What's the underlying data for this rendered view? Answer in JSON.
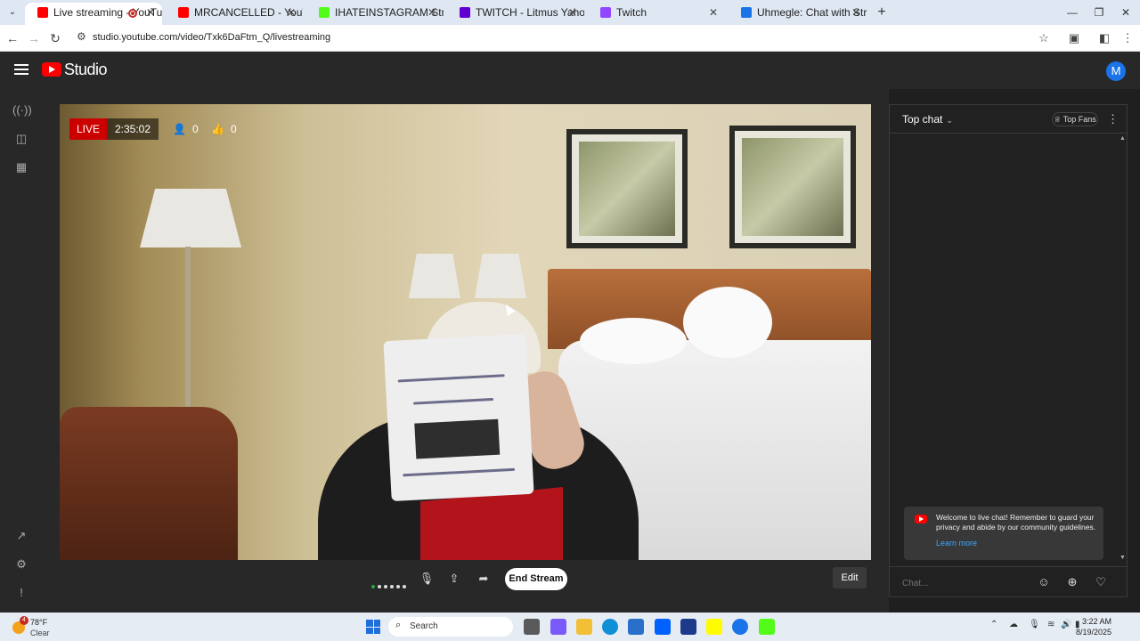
{
  "browser": {
    "tabs": [
      {
        "title": "Live streaming - YouTube Studio",
        "color": "#ff0000",
        "active": true
      },
      {
        "title": "MRCANCELLED - YouTube",
        "color": "#ff0000"
      },
      {
        "title": "IHATEINSTAGRAM Stream - Watch",
        "color": "#53fc18"
      },
      {
        "title": "TWITCH - Litmus Yahoo Search",
        "color": "#6001d2"
      },
      {
        "title": "Twitch",
        "color": "#9146ff"
      },
      {
        "title": "Uhmegle: Chat with Strangers | ...",
        "color": "#1a73e8"
      }
    ],
    "url": "studio.youtube.com/video/Txk6DaFtm_Q/livestreaming"
  },
  "studio": {
    "logo_text": "Studio",
    "avatar_letter": "M"
  },
  "stream": {
    "live_label": "LIVE",
    "elapsed": "2:35:02",
    "viewers": "0",
    "likes": "0"
  },
  "controls": {
    "end_stream_label": "End Stream",
    "edit_label": "Edit"
  },
  "chat": {
    "mode_label": "Top chat",
    "top_fans_label": "Top Fans",
    "welcome_message": "Welcome to live chat! Remember to guard your privacy and abide by our community guidelines.",
    "learn_more_label": "Learn more",
    "input_placeholder": "Chat..."
  },
  "taskbar": {
    "weather_temp": "78°F",
    "weather_cond": "Clear",
    "weather_badge": "4",
    "search_label": "Search",
    "time": "3:22 AM",
    "date": "8/19/2025"
  }
}
